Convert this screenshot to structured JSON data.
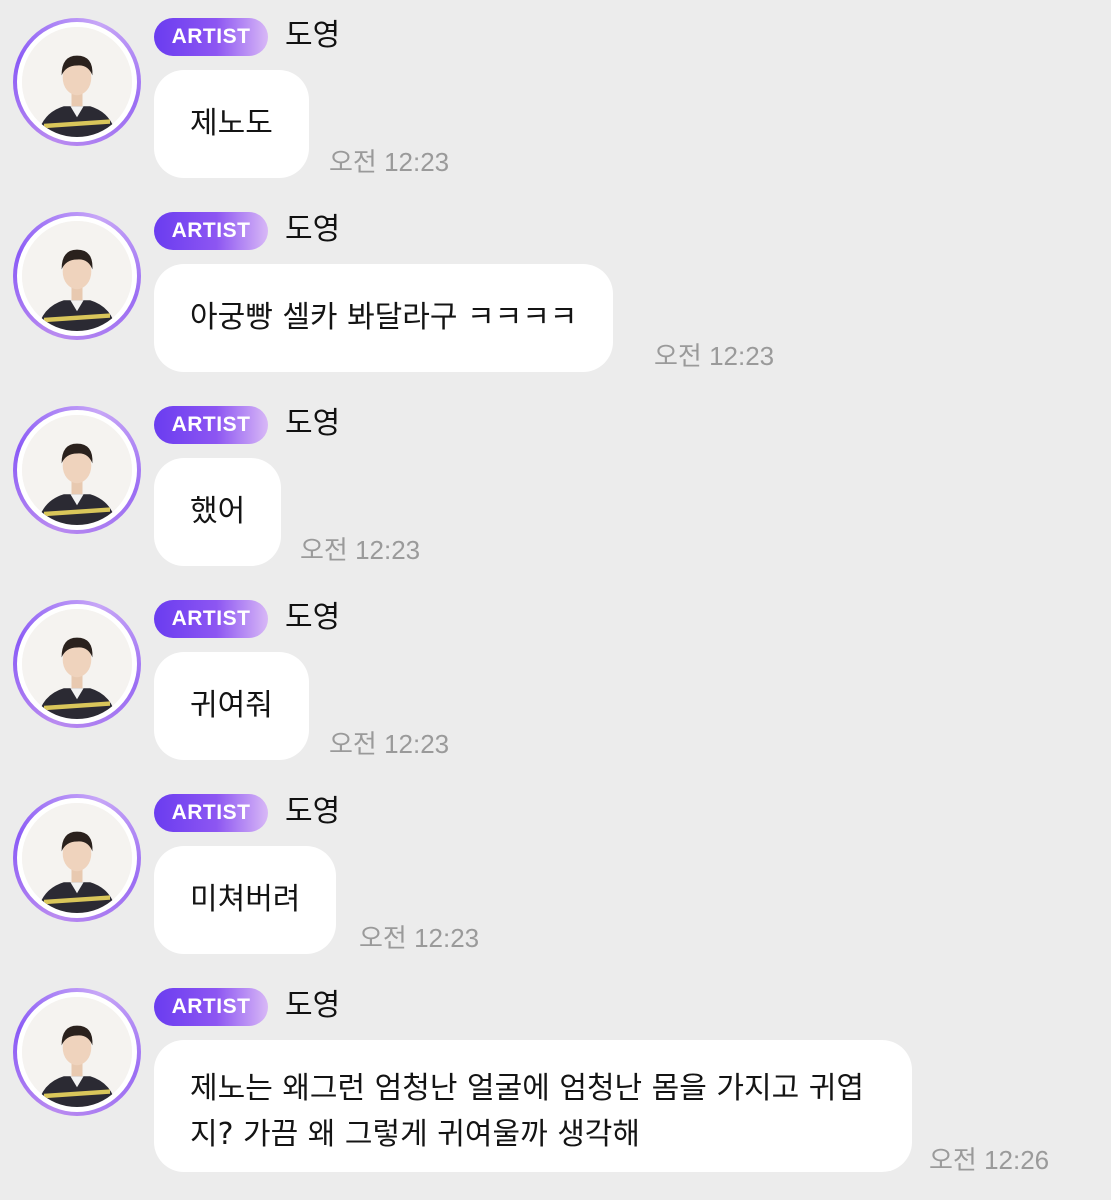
{
  "messages": [
    {
      "badge": "ARTIST",
      "sender": "도영",
      "text": "제노도",
      "time": "오전 12:23"
    },
    {
      "badge": "ARTIST",
      "sender": "도영",
      "text": "아궁빵 셀카 봐달라구 ㅋㅋㅋㅋ",
      "time": "오전 12:23"
    },
    {
      "badge": "ARTIST",
      "sender": "도영",
      "text": "했어",
      "time": "오전 12:23"
    },
    {
      "badge": "ARTIST",
      "sender": "도영",
      "text": "귀여줘",
      "time": "오전 12:23"
    },
    {
      "badge": "ARTIST",
      "sender": "도영",
      "text": "미쳐버려",
      "time": "오전 12:23"
    },
    {
      "badge": "ARTIST",
      "sender": "도영",
      "text": "제노는 왜그런 엄청난 얼굴에 엄청난 몸을 가지고 귀엽지? 가끔 왜 그렇게 귀여울까 생각해",
      "time": "오전 12:26"
    }
  ],
  "colors": {
    "background": "#ececec",
    "bubble": "#ffffff",
    "badge_start": "#6a3cf0",
    "badge_end": "#d8b8f6",
    "timestamp": "#9a9a9a"
  },
  "icons": {
    "avatar": "artist-profile-photo"
  }
}
